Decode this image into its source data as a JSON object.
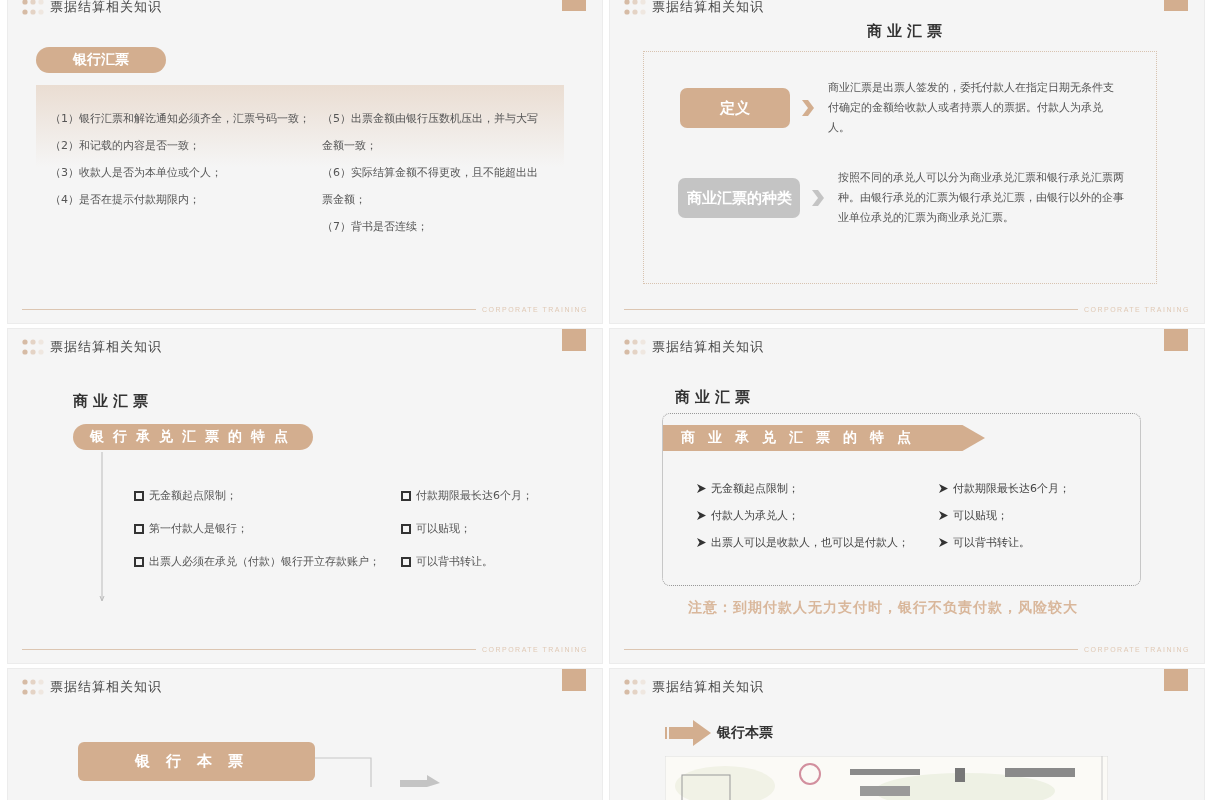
{
  "slides": [
    {
      "kind": "draft_list",
      "header": "票据结算相关知识",
      "pill": "银行汇票",
      "left_items": [
        "（1）银行汇票和解讫通知必须齐全，汇票号码一致；",
        "（2）和记载的内容是否一致；",
        "（3）收款人是否为本单位或个人；",
        "（4）是否在提示付款期限内；"
      ],
      "right_items": [
        "（5）出票金额由银行压数机压出，并与大写金额一致；",
        "（6）实际结算金额不得更改，且不能超出出票金额；",
        "（7）背书是否连续；"
      ],
      "footer": "CORPORATE TRAINING"
    },
    {
      "kind": "definition",
      "header": "票据结算相关知识",
      "title": "商业汇票",
      "rows": [
        {
          "label": "定义",
          "active": true,
          "text": "商业汇票是出票人签发的，委托付款人在指定日期无条件支付确定的金额给收款人或者持票人的票据。付款人为承兑人。"
        },
        {
          "label": "商业汇票的种类",
          "active": false,
          "text": "按照不同的承兑人可以分为商业承兑汇票和银行承兑汇票两种。由银行承兑的汇票为银行承兑汇票，由银行以外的企事业单位承兑的汇票为商业承兑汇票。"
        }
      ],
      "footer": "CORPORATE TRAINING"
    },
    {
      "kind": "bank_features",
      "header": "票据结算相关知识",
      "title": "商业汇票",
      "pill": "银行承兑汇票的特点",
      "left_items": [
        "无金额起点限制；",
        "第一付款人是银行；",
        "出票人必须在承兑（付款）银行开立存款账户；"
      ],
      "right_items": [
        "付款期限最长达6个月；",
        "可以贴现；",
        "可以背书转让。"
      ],
      "footer": "CORPORATE TRAINING"
    },
    {
      "kind": "commercial_features",
      "header": "票据结算相关知识",
      "title": "商业汇票",
      "banner": "商业承兑汇票的特点",
      "left_items": [
        "无金额起点限制；",
        "付款人为承兑人；",
        "出票人可以是收款人，也可以是付款人；"
      ],
      "right_items": [
        "付款期限最长达6个月；",
        "可以贴现；",
        "可以背书转让。"
      ],
      "note": "注意：到期付款人无力支付时，银行不负责付款，风险较大",
      "footer": "CORPORATE TRAINING"
    },
    {
      "kind": "promissory",
      "header": "票据结算相关知识",
      "box": "银行本票"
    },
    {
      "header": "票据结算相关知识",
      "heading": "银行本票"
    }
  ]
}
